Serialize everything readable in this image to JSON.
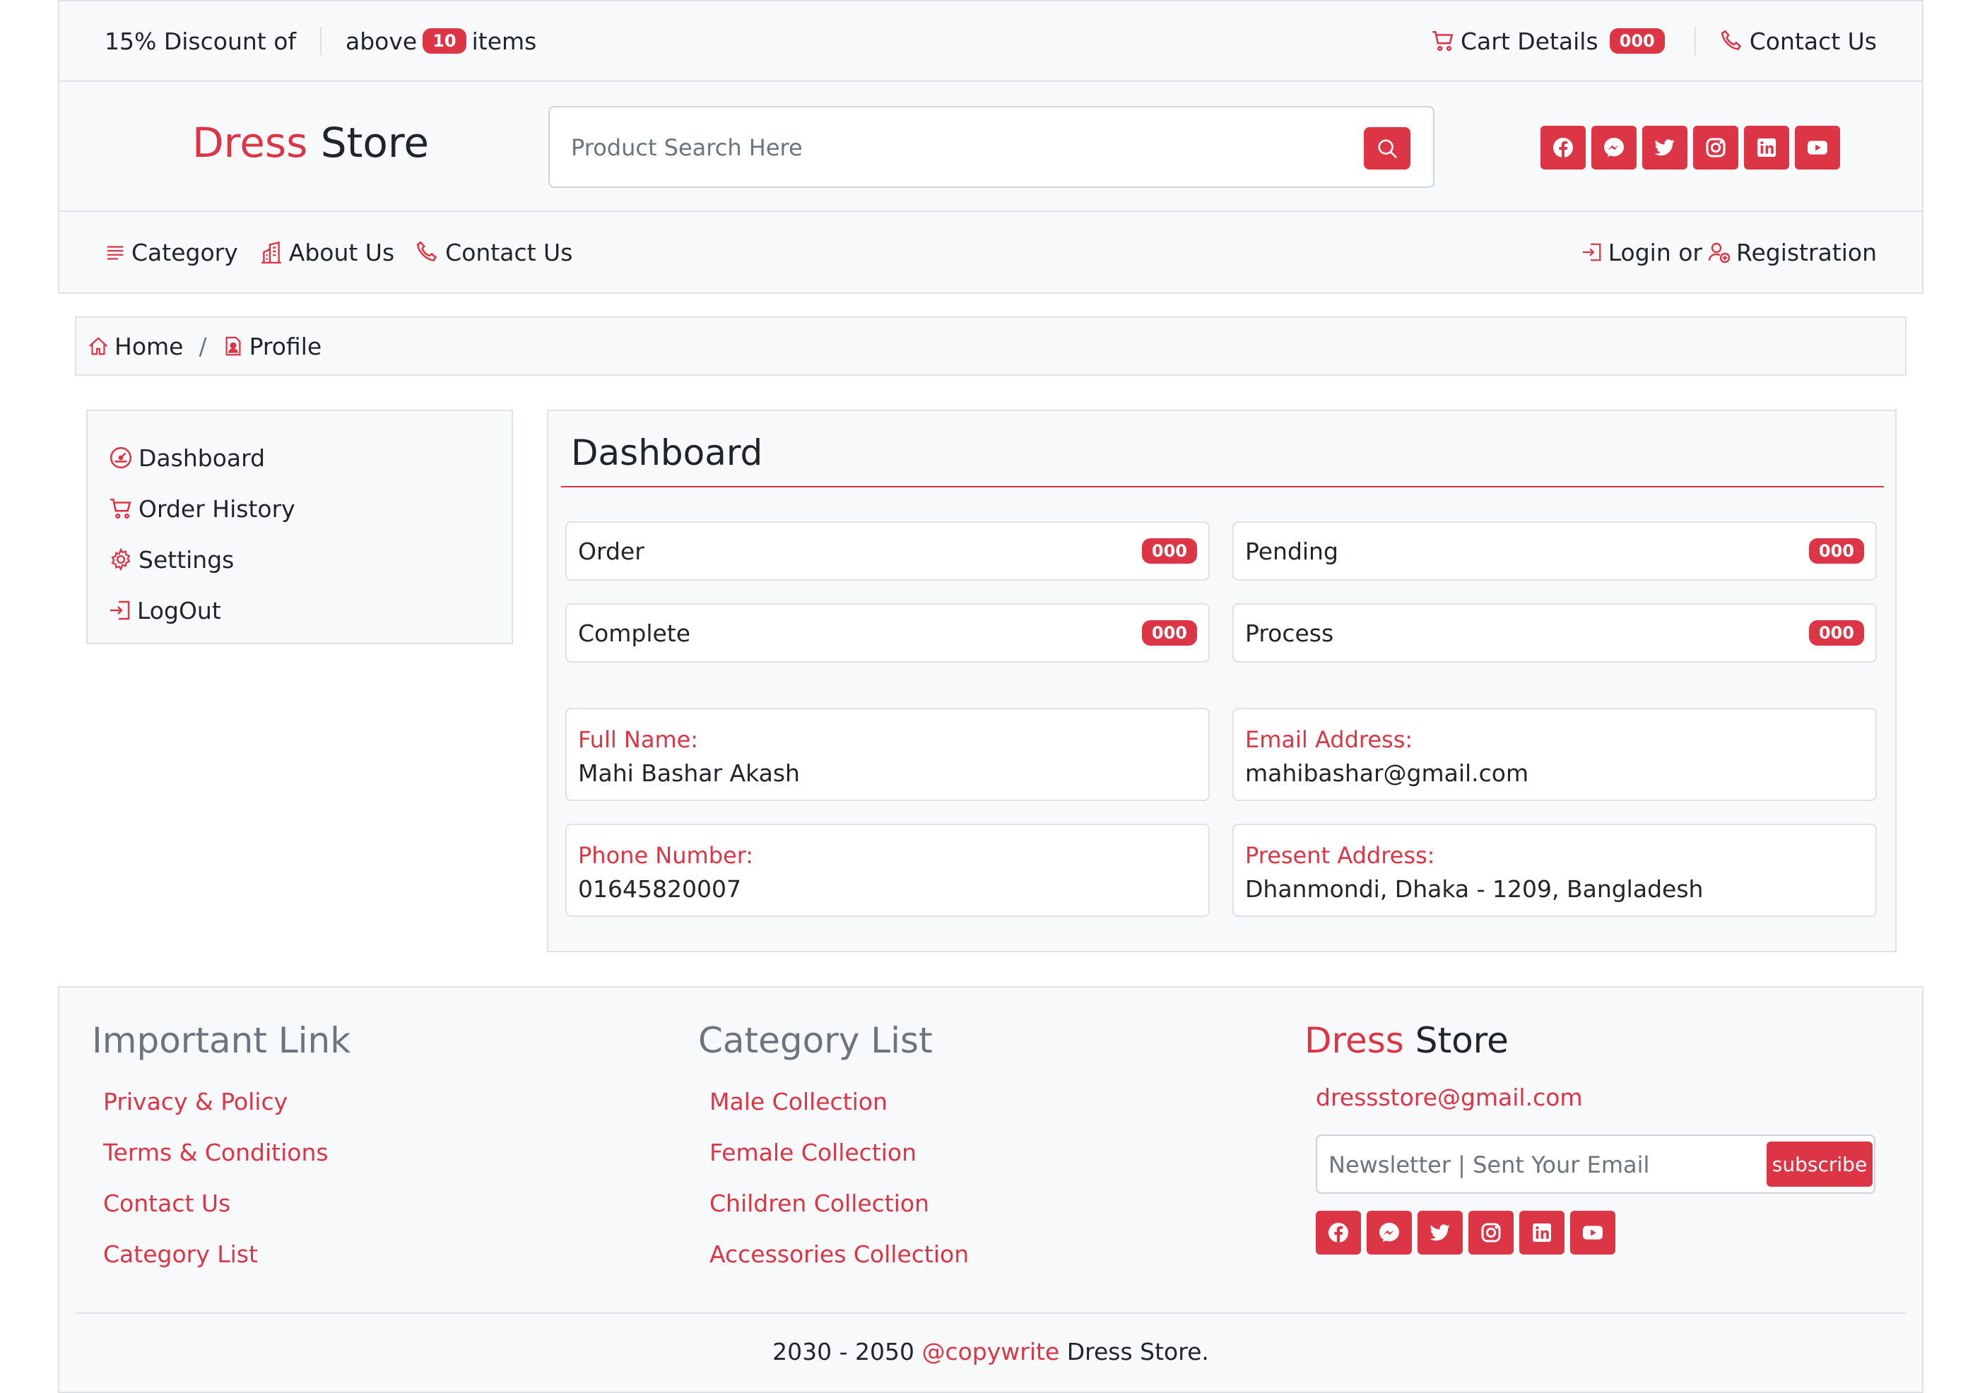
{
  "topbar": {
    "promo_text": "15% Discount of",
    "above_text": "above",
    "items_count": "10",
    "items_text": "items",
    "cart_label": "Cart Details",
    "cart_count": "000",
    "contact_label": "Contact Us"
  },
  "header": {
    "logo_first": "Dress",
    "logo_second": "Store",
    "search_placeholder": "Product Search Here",
    "socials": [
      "facebook-icon",
      "messenger-icon",
      "twitter-icon",
      "instagram-icon",
      "linkedin-icon",
      "youtube-icon"
    ]
  },
  "nav": {
    "category": "Category",
    "about": "About Us",
    "contact": "Contact Us",
    "login": "Login or",
    "registration": "Registration"
  },
  "breadcrumb": {
    "home": "Home",
    "separator": "/",
    "current": "Profile"
  },
  "sidebar": {
    "items": [
      {
        "label": "Dashboard",
        "icon": "speedometer-icon"
      },
      {
        "label": "Order History",
        "icon": "cart-icon"
      },
      {
        "label": "Settings",
        "icon": "gear-icon"
      },
      {
        "label": "LogOut",
        "icon": "logout-icon"
      }
    ]
  },
  "dashboard": {
    "title": "Dashboard",
    "stats": [
      {
        "label": "Order",
        "count": "000"
      },
      {
        "label": "Pending",
        "count": "000"
      },
      {
        "label": "Complete",
        "count": "000"
      },
      {
        "label": "Process",
        "count": "000"
      }
    ],
    "info": [
      {
        "label": "Full Name:",
        "value": "Mahi Bashar Akash"
      },
      {
        "label": "Email Address:",
        "value": "mahibashar@gmail.com"
      },
      {
        "label": "Phone Number:",
        "value": "01645820007"
      },
      {
        "label": "Present Address:",
        "value": "Dhanmondi, Dhaka - 1209, Bangladesh"
      }
    ]
  },
  "footer": {
    "col1_title": "Important Link",
    "col1_links": [
      "Privacy & Policy",
      "Terms & Conditions",
      "Contact Us",
      "Category List"
    ],
    "col2_title": "Category List",
    "col2_links": [
      "Male Collection",
      "Female Collection",
      "Children Collection",
      "Accessories Collection"
    ],
    "col3_logo_first": "Dress",
    "col3_logo_second": "Store",
    "email": "dressstore@gmail.com",
    "newsletter_placeholder": "Newsletter | Sent Your Email",
    "subscribe_label": "subscribe",
    "copy_years": "2030 - 2050",
    "copy_link": "@copywrite",
    "copy_brand": "Dress Store."
  },
  "colors": {
    "accent": "#dc3545",
    "panel_bg": "#f8f9fa",
    "border": "#dee2e6"
  }
}
